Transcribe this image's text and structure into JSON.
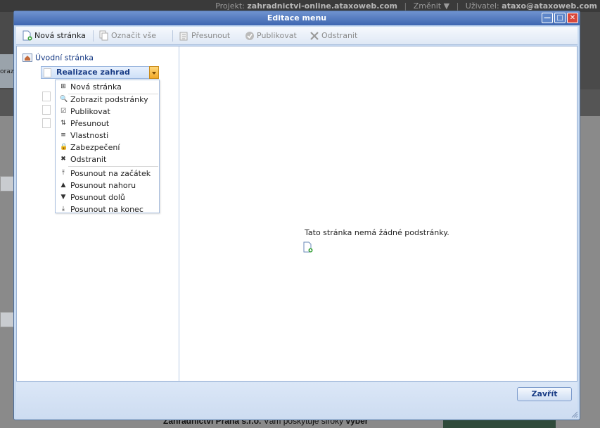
{
  "background": {
    "topbar": {
      "project_label": "Projekt:",
      "project_value": "zahradnictvi-online.ataxoweb.com",
      "change_label": "Změnit ▼",
      "user_label": "Uživatel:",
      "user_value": "ataxo@ataxoweb.com"
    },
    "thumb_text": "oraz",
    "footer_text_bold": "Zahradnictví Praha s.r.o.",
    "footer_text": " Vám poskytuje široký ",
    "footer_text_end": "výběr"
  },
  "dialog": {
    "title": "Editace menu",
    "window_buttons": {
      "minimize": "—",
      "maximize": "□",
      "close": "✕"
    },
    "toolbar": {
      "new_page": "Nová stránka",
      "select_all": "Označit vše",
      "move": "Přesunout",
      "publish": "Publikovat",
      "delete": "Odstranit"
    },
    "tree": {
      "root_label": "Úvodní stránka",
      "selected_label": "Realizace zahrad"
    },
    "context_menu": {
      "items": [
        {
          "icon": "⊞",
          "label": "Nová stránka"
        },
        {
          "icon": "🔍",
          "label": "Zobrazit podstránky"
        },
        {
          "icon": "☑",
          "label": "Publikovat"
        },
        {
          "icon": "⇅",
          "label": "Přesunout"
        },
        {
          "icon": "≡",
          "label": "Vlastnosti"
        },
        {
          "icon": "🔒",
          "label": "Zabezpečení"
        },
        {
          "icon": "✖",
          "label": "Odstranit"
        },
        {
          "icon": "⤒",
          "label": "Posunout na začátek"
        },
        {
          "icon": "▲",
          "label": "Posunout nahoru"
        },
        {
          "icon": "▼",
          "label": "Posunout dolů"
        },
        {
          "icon": "⤓",
          "label": "Posunout na konec"
        }
      ]
    },
    "detail": {
      "empty_message": "Tato stránka nemá žádné podstránky."
    },
    "footer": {
      "close_label": "Zavřít"
    }
  },
  "colors": {
    "titlebar": "#3f67b1",
    "dialog_bg": "#c9dcf3",
    "link_text": "#1a3d86",
    "dropdown_accent": "#f2a928"
  }
}
